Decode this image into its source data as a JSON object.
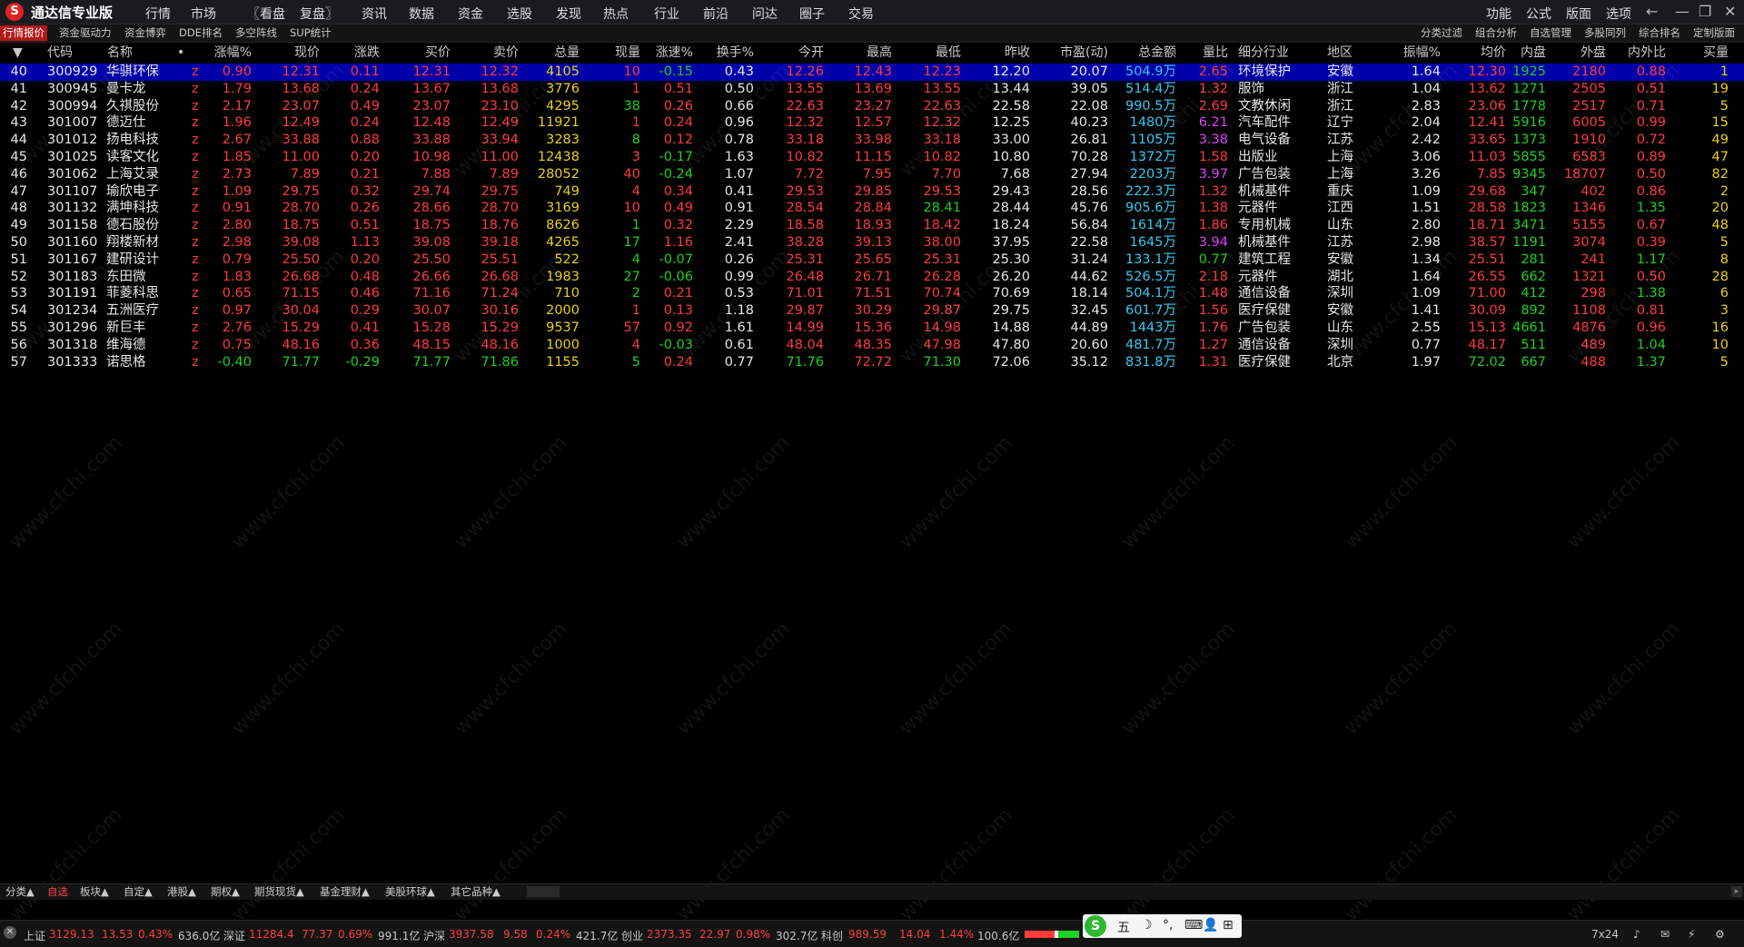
{
  "app": {
    "title": "通达信专业版",
    "logo": "S"
  },
  "menu": [
    "行情",
    "市场",
    "〖看盘",
    "复盘〗",
    "资讯",
    "数据",
    "资金",
    "选股",
    "发现",
    "热点",
    "行业",
    "前沿",
    "问达",
    "圈子",
    "交易"
  ],
  "right_menu": [
    "功能",
    "公式",
    "版面",
    "选项"
  ],
  "window_buttons": [
    "←",
    "—",
    "❐",
    "✕"
  ],
  "tabs": [
    "行情报价",
    "资金驱动力",
    "资金博弈",
    "DDE排名",
    "多空阵线",
    "SUP统计"
  ],
  "right_tabs": [
    "分类过滤",
    "组合分析",
    "自选管理",
    "多股同列",
    "综合排名",
    "定制版面"
  ],
  "headers": {
    "sort": "▼",
    "code": "代码",
    "name": "名称",
    "dot": "•",
    "pct": "涨幅%",
    "price": "现价",
    "chg": "涨跌",
    "bid": "买价",
    "ask": "卖价",
    "vol": "总量",
    "cur": "现量",
    "speed": "涨速%",
    "turn": "换手%",
    "open": "今开",
    "high": "最高",
    "low": "最低",
    "prev": "昨收",
    "pe": "市盈(动)",
    "amount": "总金额",
    "ratio": "量比",
    "industry": "细分行业",
    "region": "地区",
    "amp": "振幅%",
    "avg": "均价",
    "inner": "内盘",
    "outer": "外盘",
    "io": "内外比",
    "bidvol": "买量"
  },
  "rows": [
    {
      "no": "40",
      "code": "300929",
      "name": "华骐环保",
      "z": "z",
      "pct": "0.90",
      "price": "12.31",
      "chg": "0.11",
      "bid": "12.31",
      "ask": "12.32",
      "vol": "4105",
      "cur": "10",
      "speed": "-0.15",
      "turn": "0.43",
      "open": "12.26",
      "high": "12.43",
      "low": "12.23",
      "prev": "12.20",
      "pe": "20.07",
      "amount": "504.9万",
      "ratio": "2.65",
      "industry": "环境保护",
      "region": "安徽",
      "amp": "1.64",
      "avg": "12.30",
      "inner": "1925",
      "outer": "2180",
      "io": "0.88",
      "bidvol": "1"
    },
    {
      "no": "41",
      "code": "300945",
      "name": "曼卡龙",
      "z": "z",
      "pct": "1.79",
      "price": "13.68",
      "chg": "0.24",
      "bid": "13.67",
      "ask": "13.68",
      "vol": "3776",
      "cur": "1",
      "speed": "0.51",
      "turn": "0.50",
      "open": "13.55",
      "high": "13.69",
      "low": "13.55",
      "prev": "13.44",
      "pe": "39.05",
      "amount": "514.4万",
      "ratio": "1.32",
      "industry": "服饰",
      "region": "浙江",
      "amp": "1.04",
      "avg": "13.62",
      "inner": "1271",
      "outer": "2505",
      "io": "0.51",
      "bidvol": "19"
    },
    {
      "no": "42",
      "code": "300994",
      "name": "久祺股份",
      "z": "z",
      "pct": "2.17",
      "price": "23.07",
      "chg": "0.49",
      "bid": "23.07",
      "ask": "23.10",
      "vol": "4295",
      "cur": "38",
      "speed": "0.26",
      "turn": "0.66",
      "open": "22.63",
      "high": "23.27",
      "low": "22.63",
      "prev": "22.58",
      "pe": "22.08",
      "amount": "990.5万",
      "ratio": "2.69",
      "industry": "文教休闲",
      "region": "浙江",
      "amp": "2.83",
      "avg": "23.06",
      "inner": "1778",
      "outer": "2517",
      "io": "0.71",
      "bidvol": "5"
    },
    {
      "no": "43",
      "code": "301007",
      "name": "德迈仕",
      "z": "z",
      "pct": "1.96",
      "price": "12.49",
      "chg": "0.24",
      "bid": "12.48",
      "ask": "12.49",
      "vol": "11921",
      "cur": "1",
      "speed": "0.24",
      "turn": "0.96",
      "open": "12.32",
      "high": "12.57",
      "low": "12.32",
      "prev": "12.25",
      "pe": "40.23",
      "amount": "1480万",
      "ratio": "6.21",
      "industry": "汽车配件",
      "region": "辽宁",
      "amp": "2.04",
      "avg": "12.41",
      "inner": "5916",
      "outer": "6005",
      "io": "0.99",
      "bidvol": "15"
    },
    {
      "no": "44",
      "code": "301012",
      "name": "扬电科技",
      "z": "z",
      "pct": "2.67",
      "price": "33.88",
      "chg": "0.88",
      "bid": "33.88",
      "ask": "33.94",
      "vol": "3283",
      "cur": "8",
      "speed": "0.12",
      "turn": "0.78",
      "open": "33.18",
      "high": "33.98",
      "low": "33.18",
      "prev": "33.00",
      "pe": "26.81",
      "amount": "1105万",
      "ratio": "3.38",
      "industry": "电气设备",
      "region": "江苏",
      "amp": "2.42",
      "avg": "33.65",
      "inner": "1373",
      "outer": "1910",
      "io": "0.72",
      "bidvol": "49"
    },
    {
      "no": "45",
      "code": "301025",
      "name": "读客文化",
      "z": "z",
      "pct": "1.85",
      "price": "11.00",
      "chg": "0.20",
      "bid": "10.98",
      "ask": "11.00",
      "vol": "12438",
      "cur": "3",
      "speed": "-0.17",
      "turn": "1.63",
      "open": "10.82",
      "high": "11.15",
      "low": "10.82",
      "prev": "10.80",
      "pe": "70.28",
      "amount": "1372万",
      "ratio": "1.58",
      "industry": "出版业",
      "region": "上海",
      "amp": "3.06",
      "avg": "11.03",
      "inner": "5855",
      "outer": "6583",
      "io": "0.89",
      "bidvol": "47"
    },
    {
      "no": "46",
      "code": "301062",
      "name": "上海艾录",
      "z": "z",
      "pct": "2.73",
      "price": "7.89",
      "chg": "0.21",
      "bid": "7.88",
      "ask": "7.89",
      "vol": "28052",
      "cur": "40",
      "speed": "-0.24",
      "turn": "1.07",
      "open": "7.72",
      "high": "7.95",
      "low": "7.70",
      "prev": "7.68",
      "pe": "27.94",
      "amount": "2203万",
      "ratio": "3.97",
      "industry": "广告包装",
      "region": "上海",
      "amp": "3.26",
      "avg": "7.85",
      "inner": "9345",
      "outer": "18707",
      "io": "0.50",
      "bidvol": "82"
    },
    {
      "no": "47",
      "code": "301107",
      "name": "瑜欣电子",
      "z": "z",
      "pct": "1.09",
      "price": "29.75",
      "chg": "0.32",
      "bid": "29.74",
      "ask": "29.75",
      "vol": "749",
      "cur": "4",
      "speed": "0.34",
      "turn": "0.41",
      "open": "29.53",
      "high": "29.85",
      "low": "29.53",
      "prev": "29.43",
      "pe": "28.56",
      "amount": "222.3万",
      "ratio": "1.32",
      "industry": "机械基件",
      "region": "重庆",
      "amp": "1.09",
      "avg": "29.68",
      "inner": "347",
      "outer": "402",
      "io": "0.86",
      "bidvol": "2"
    },
    {
      "no": "48",
      "code": "301132",
      "name": "满坤科技",
      "z": "z",
      "pct": "0.91",
      "price": "28.70",
      "chg": "0.26",
      "bid": "28.66",
      "ask": "28.70",
      "vol": "3169",
      "cur": "10",
      "speed": "0.49",
      "turn": "0.91",
      "open": "28.54",
      "high": "28.84",
      "low": "28.41",
      "prev": "28.44",
      "pe": "45.76",
      "amount": "905.6万",
      "ratio": "1.38",
      "industry": "元器件",
      "region": "江西",
      "amp": "1.51",
      "avg": "28.58",
      "inner": "1823",
      "outer": "1346",
      "io": "1.35",
      "bidvol": "20"
    },
    {
      "no": "49",
      "code": "301158",
      "name": "德石股份",
      "z": "z",
      "pct": "2.80",
      "price": "18.75",
      "chg": "0.51",
      "bid": "18.75",
      "ask": "18.76",
      "vol": "8626",
      "cur": "1",
      "speed": "0.32",
      "turn": "2.29",
      "open": "18.58",
      "high": "18.93",
      "low": "18.42",
      "prev": "18.24",
      "pe": "56.84",
      "amount": "1614万",
      "ratio": "1.86",
      "industry": "专用机械",
      "region": "山东",
      "amp": "2.80",
      "avg": "18.71",
      "inner": "3471",
      "outer": "5155",
      "io": "0.67",
      "bidvol": "48"
    },
    {
      "no": "50",
      "code": "301160",
      "name": "翔楼新材",
      "z": "z",
      "pct": "2.98",
      "price": "39.08",
      "chg": "1.13",
      "bid": "39.08",
      "ask": "39.18",
      "vol": "4265",
      "cur": "17",
      "speed": "1.16",
      "turn": "2.41",
      "open": "38.28",
      "high": "39.13",
      "low": "38.00",
      "prev": "37.95",
      "pe": "22.58",
      "amount": "1645万",
      "ratio": "3.94",
      "industry": "机械基件",
      "region": "江苏",
      "amp": "2.98",
      "avg": "38.57",
      "inner": "1191",
      "outer": "3074",
      "io": "0.39",
      "bidvol": "5"
    },
    {
      "no": "51",
      "code": "301167",
      "name": "建研设计",
      "z": "z",
      "pct": "0.79",
      "price": "25.50",
      "chg": "0.20",
      "bid": "25.50",
      "ask": "25.51",
      "vol": "522",
      "cur": "4",
      "speed": "-0.07",
      "turn": "0.26",
      "open": "25.31",
      "high": "25.65",
      "low": "25.31",
      "prev": "25.30",
      "pe": "31.24",
      "amount": "133.1万",
      "ratio": "0.77",
      "industry": "建筑工程",
      "region": "安徽",
      "amp": "1.34",
      "avg": "25.51",
      "inner": "281",
      "outer": "241",
      "io": "1.17",
      "bidvol": "8"
    },
    {
      "no": "52",
      "code": "301183",
      "name": "东田微",
      "z": "z",
      "pct": "1.83",
      "price": "26.68",
      "chg": "0.48",
      "bid": "26.66",
      "ask": "26.68",
      "vol": "1983",
      "cur": "27",
      "speed": "-0.06",
      "turn": "0.99",
      "open": "26.48",
      "high": "26.71",
      "low": "26.28",
      "prev": "26.20",
      "pe": "44.62",
      "amount": "526.5万",
      "ratio": "2.18",
      "industry": "元器件",
      "region": "湖北",
      "amp": "1.64",
      "avg": "26.55",
      "inner": "662",
      "outer": "1321",
      "io": "0.50",
      "bidvol": "28"
    },
    {
      "no": "53",
      "code": "301191",
      "name": "菲菱科思",
      "z": "z",
      "pct": "0.65",
      "price": "71.15",
      "chg": "0.46",
      "bid": "71.16",
      "ask": "71.24",
      "vol": "710",
      "cur": "2",
      "speed": "0.21",
      "turn": "0.53",
      "open": "71.01",
      "high": "71.51",
      "low": "70.74",
      "prev": "70.69",
      "pe": "18.14",
      "amount": "504.1万",
      "ratio": "1.48",
      "industry": "通信设备",
      "region": "深圳",
      "amp": "1.09",
      "avg": "71.00",
      "inner": "412",
      "outer": "298",
      "io": "1.38",
      "bidvol": "6"
    },
    {
      "no": "54",
      "code": "301234",
      "name": "五洲医疗",
      "z": "z",
      "pct": "0.97",
      "price": "30.04",
      "chg": "0.29",
      "bid": "30.07",
      "ask": "30.16",
      "vol": "2000",
      "cur": "1",
      "speed": "0.13",
      "turn": "1.18",
      "open": "29.87",
      "high": "30.29",
      "low": "29.87",
      "prev": "29.75",
      "pe": "32.45",
      "amount": "601.7万",
      "ratio": "1.56",
      "industry": "医疗保健",
      "region": "安徽",
      "amp": "1.41",
      "avg": "30.09",
      "inner": "892",
      "outer": "1108",
      "io": "0.81",
      "bidvol": "3"
    },
    {
      "no": "55",
      "code": "301296",
      "name": "新巨丰",
      "z": "z",
      "pct": "2.76",
      "price": "15.29",
      "chg": "0.41",
      "bid": "15.28",
      "ask": "15.29",
      "vol": "9537",
      "cur": "57",
      "speed": "0.92",
      "turn": "1.61",
      "open": "14.99",
      "high": "15.36",
      "low": "14.98",
      "prev": "14.88",
      "pe": "44.89",
      "amount": "1443万",
      "ratio": "1.76",
      "industry": "广告包装",
      "region": "山东",
      "amp": "2.55",
      "avg": "15.13",
      "inner": "4661",
      "outer": "4876",
      "io": "0.96",
      "bidvol": "16"
    },
    {
      "no": "56",
      "code": "301318",
      "name": "维海德",
      "z": "z",
      "pct": "0.75",
      "price": "48.16",
      "chg": "0.36",
      "bid": "48.15",
      "ask": "48.16",
      "vol": "1000",
      "cur": "4",
      "speed": "-0.03",
      "turn": "0.61",
      "open": "48.04",
      "high": "48.35",
      "low": "47.98",
      "prev": "47.80",
      "pe": "20.60",
      "amount": "481.7万",
      "ratio": "1.27",
      "industry": "通信设备",
      "region": "深圳",
      "amp": "0.77",
      "avg": "48.17",
      "inner": "511",
      "outer": "489",
      "io": "1.04",
      "bidvol": "10"
    },
    {
      "no": "57",
      "code": "301333",
      "name": "诺思格",
      "z": "z",
      "pct": "-0.40",
      "price": "71.77",
      "chg": "-0.29",
      "bid": "71.77",
      "ask": "71.86",
      "vol": "1155",
      "cur": "5",
      "speed": "0.24",
      "turn": "0.77",
      "open": "71.76",
      "high": "72.72",
      "low": "71.30",
      "prev": "72.06",
      "pe": "35.12",
      "amount": "831.8万",
      "ratio": "1.31",
      "industry": "医疗保健",
      "region": "北京",
      "amp": "1.97",
      "avg": "72.02",
      "inner": "667",
      "outer": "488",
      "io": "1.37",
      "bidvol": "5"
    }
  ],
  "watermark": "www.cfchi.com",
  "bottom_tabs": [
    "分类▲",
    "自选",
    "板块▲",
    "自定▲",
    "港股▲",
    "期权▲",
    "期货现货▲",
    "基金理财▲",
    "美股环球▲",
    "其它品种▲"
  ],
  "status": {
    "sh_label": "上证",
    "sh_val": "3129.13",
    "sh_chg": "13.53",
    "sh_pct": "0.43%",
    "sh_amt": "636.0亿",
    "sz_label": "深证",
    "sz_val": "11284.4",
    "sz_chg": "77.37",
    "sz_pct": "0.69%",
    "sz_amt": "991.1亿",
    "hs_label": "沪深",
    "hs_val": "3937.58",
    "hs_chg": "9.58",
    "hs_pct": "0.24%",
    "hs_amt": "421.7亿",
    "cy_label": "创业",
    "cy_val": "2373.35",
    "cy_chg": "22.97",
    "cy_pct": "0.98%",
    "cy_amt": "302.7亿",
    "kc_label": "科创",
    "kc_val": "989.59",
    "kc_chg": "14.04",
    "kc_pct": "1.44%",
    "kc_amt": "100.6亿",
    "time": "7x24"
  },
  "ime": {
    "logo": "S",
    "mode": "五",
    "items": [
      "☽",
      "°,",
      "⌨",
      "👤",
      "⊞"
    ]
  },
  "colors": {
    "up": "#ff3c3c",
    "down": "#1fd11f",
    "selected_row": "#0000a8",
    "volume": "#e8d020",
    "amount": "#38c8f0",
    "ratio_high": "#e040fb"
  }
}
